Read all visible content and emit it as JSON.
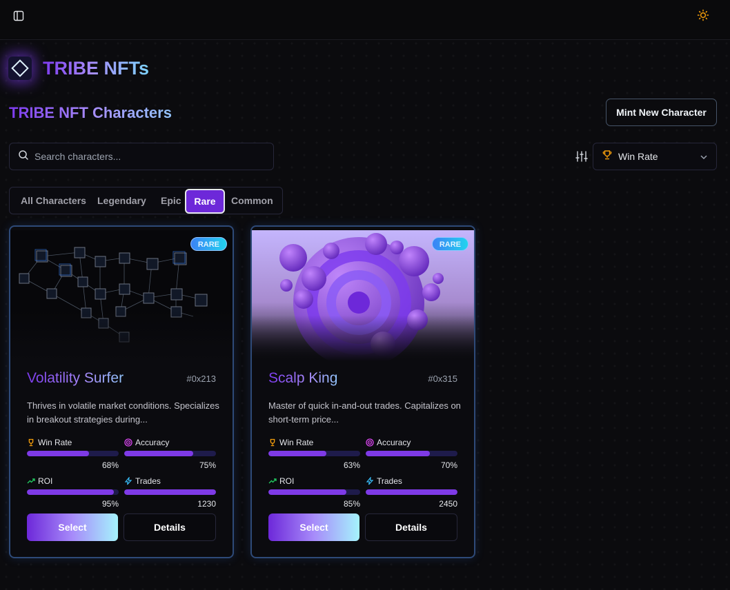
{
  "header": {
    "sidebar_icon": "sidebar-toggle-icon",
    "theme_icon": "sun-icon"
  },
  "brand": {
    "name": "TRIBE NFTs",
    "logo_icon": "diamond-logo-icon"
  },
  "page": {
    "title": "TRIBE NFT Characters",
    "mint_button": "Mint New Character"
  },
  "search": {
    "placeholder": "Search characters...",
    "value": ""
  },
  "sort": {
    "selected": "Win Rate",
    "icon": "trophy-icon"
  },
  "tabs": [
    {
      "label": "All Characters",
      "active": false
    },
    {
      "label": "Legendary",
      "active": false
    },
    {
      "label": "Epic",
      "active": false
    },
    {
      "label": "Rare",
      "active": true
    },
    {
      "label": "Common",
      "active": false
    }
  ],
  "colors": {
    "accent": "#6d28d9",
    "bar": "#7e3ae6",
    "badge": "#3b82f6",
    "card_border": "#2e4a78"
  },
  "cards": [
    {
      "name": "Volatility Surfer",
      "id": "#0x213",
      "rarity": "RARE",
      "description": "Thrives in volatile market conditions. Specializes in breakout strategies during...",
      "image": "network-cubes-image",
      "stats": [
        {
          "label": "Win Rate",
          "value": "68%",
          "fraction": 0.68,
          "icon": "trophy-icon"
        },
        {
          "label": "Accuracy",
          "value": "75%",
          "fraction": 0.75,
          "icon": "target-icon"
        },
        {
          "label": "ROI",
          "value": "95%",
          "fraction": 0.95,
          "icon": "trending-up-icon"
        },
        {
          "label": "Trades",
          "value": "1230",
          "fraction": 1.0,
          "icon": "lightning-icon"
        }
      ],
      "select_label": "Select",
      "details_label": "Details"
    },
    {
      "name": "Scalp King",
      "id": "#0x315",
      "rarity": "RARE",
      "description": "Master of quick in-and-out trades. Capitalizes on short-term price...",
      "image": "purple-spheres-image",
      "stats": [
        {
          "label": "Win Rate",
          "value": "63%",
          "fraction": 0.63,
          "icon": "trophy-icon"
        },
        {
          "label": "Accuracy",
          "value": "70%",
          "fraction": 0.7,
          "icon": "target-icon"
        },
        {
          "label": "ROI",
          "value": "85%",
          "fraction": 0.85,
          "icon": "trending-up-icon"
        },
        {
          "label": "Trades",
          "value": "2450",
          "fraction": 1.0,
          "icon": "lightning-icon"
        }
      ],
      "select_label": "Select",
      "details_label": "Details"
    }
  ]
}
